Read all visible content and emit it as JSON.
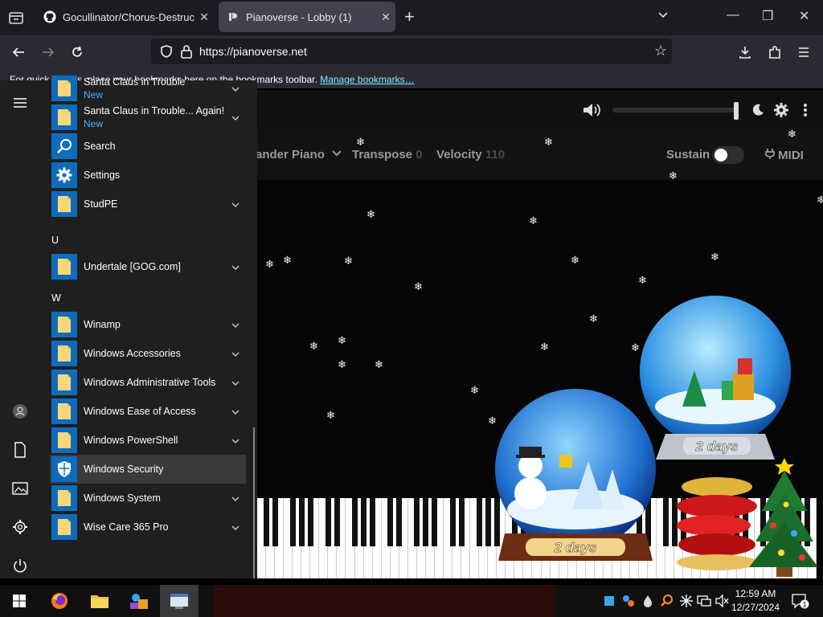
{
  "browser": {
    "tabs": [
      {
        "title": "Gocullinator/Chorus-Destructi",
        "close": "✕"
      },
      {
        "title": "Pianoverse - Lobby (1)",
        "close": "✕"
      }
    ],
    "new_tab": "+",
    "url": "https://pianoverse.net",
    "bookmarks_text": "For quick access, place your bookmarks here on the bookmarks toolbar.",
    "bookmarks_link": "Manage bookmarks…",
    "window_controls": {
      "minimize": "—",
      "restore": "❐",
      "close": "✕"
    }
  },
  "page": {
    "controls": {
      "instrument": "ander Piano",
      "transpose_label": "Transpose",
      "transpose_value": "0",
      "velocity_label": "Velocity",
      "velocity_value": "110",
      "sustain_label": "Sustain",
      "midi_label": "MIDI"
    },
    "volume_level": 1.0,
    "globes": [
      {
        "label": "2 days"
      },
      {
        "label": "2 days"
      }
    ]
  },
  "start_menu": {
    "items_top": [
      {
        "label": "Santa Claus in Trouble",
        "badge": "New",
        "chevron": true,
        "icon": "folder-icon"
      },
      {
        "label": "Santa Claus in Trouble... Again!",
        "badge": "New",
        "chevron": true,
        "icon": "folder-icon"
      },
      {
        "label": "Search",
        "chevron": false,
        "icon": "search-icon"
      },
      {
        "label": "Settings",
        "chevron": false,
        "icon": "gear-icon"
      },
      {
        "label": "StudPE",
        "chevron": true,
        "icon": "folder-icon"
      }
    ],
    "letter_u": "U",
    "items_u": [
      {
        "label": "Undertale [GOG.com]",
        "chevron": true,
        "icon": "folder-icon"
      }
    ],
    "letter_w": "W",
    "items_w": [
      {
        "label": "Winamp",
        "chevron": true,
        "icon": "folder-icon"
      },
      {
        "label": "Windows Accessories",
        "chevron": true,
        "icon": "folder-icon"
      },
      {
        "label": "Windows Administrative Tools",
        "chevron": true,
        "icon": "folder-icon"
      },
      {
        "label": "Windows Ease of Access",
        "chevron": true,
        "icon": "folder-icon"
      },
      {
        "label": "Windows PowerShell",
        "chevron": true,
        "icon": "folder-icon"
      },
      {
        "label": "Windows Security",
        "chevron": false,
        "icon": "shield-icon",
        "highlighted": true
      },
      {
        "label": "Windows System",
        "chevron": true,
        "icon": "folder-icon"
      },
      {
        "label": "Wise Care 365 Pro",
        "chevron": true,
        "icon": "folder-icon"
      }
    ]
  },
  "taskbar": {
    "time": "12:59 AM",
    "date": "12/27/2024",
    "notification_count": "1"
  },
  "colors": {
    "accent": "#0f6cbd",
    "start_menu_bg": "#1f1f1f",
    "link": "#80ebff"
  }
}
